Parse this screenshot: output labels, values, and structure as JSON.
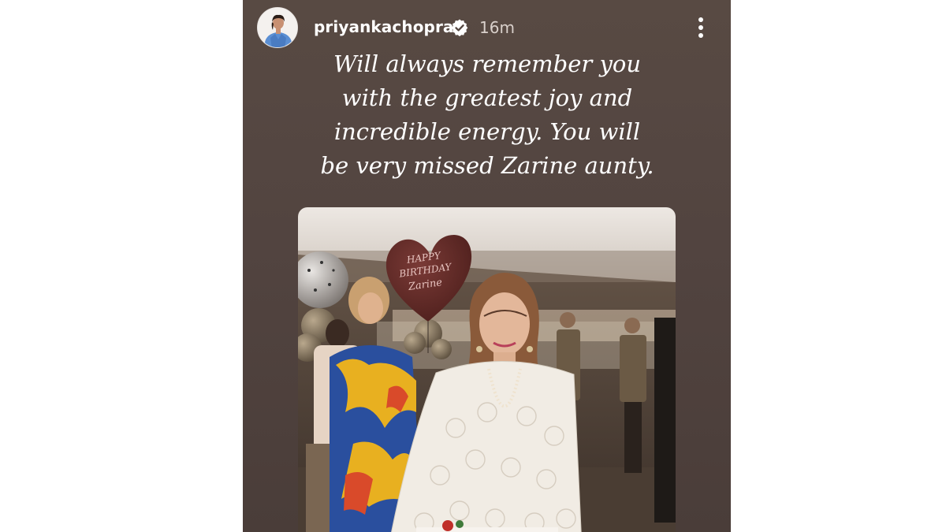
{
  "story": {
    "author": {
      "username": "priyankachopra",
      "verified": true,
      "time_ago": "16m"
    },
    "caption_lines": [
      "Will always remember you",
      "with the greatest joy and",
      "incredible energy. You will",
      "be very missed Zarine aunty."
    ],
    "photo": {
      "balloon_lines": [
        "HAPPY",
        "BIRTHDAY",
        "Zarine"
      ]
    },
    "colors": {
      "background": "#554741",
      "text": "#ffffff",
      "timestamp": "#d9d0cb"
    },
    "icons": {
      "verified": "verified-badge-icon",
      "more": "more-options-icon"
    }
  }
}
